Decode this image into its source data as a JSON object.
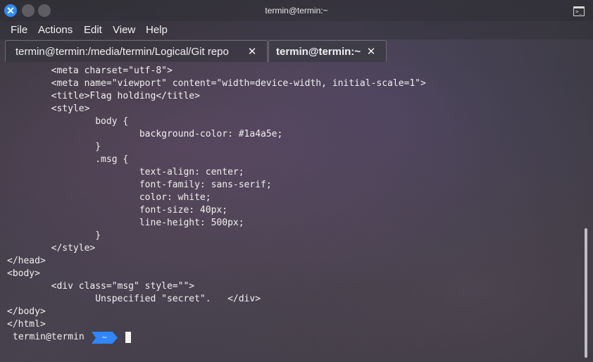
{
  "window": {
    "title": "termin@termin:~",
    "close_glyph": "✕",
    "terminal_icon_glyph": ">_",
    "icons": [
      "close-icon",
      "minimize-icon",
      "maximize-icon",
      "terminal-icon"
    ]
  },
  "menu": {
    "items": [
      {
        "label": "File"
      },
      {
        "label": "Actions"
      },
      {
        "label": "Edit"
      },
      {
        "label": "View"
      },
      {
        "label": "Help"
      }
    ]
  },
  "tabs": [
    {
      "label": "termin@termin:/media/termin/Logical/Git repo",
      "close": "✕",
      "active": false
    },
    {
      "label": "termin@termin:~",
      "close": "✕",
      "active": true
    }
  ],
  "terminal": {
    "lines": [
      "        <meta charset=\"utf-8\">",
      "        <meta name=\"viewport\" content=\"width=device-width, initial-scale=1\">",
      "        <title>Flag holding</title>",
      "        <style>",
      "                body {",
      "                        background-color: #1a4a5e;",
      "                }",
      "                .msg {",
      "                        text-align: center;",
      "                        font-family: sans-serif;",
      "                        color: white;",
      "                        font-size: 40px;",
      "                        line-height: 500px;",
      "                }",
      "        </style>",
      "</head>",
      "<body>",
      "        <div class=\"msg\" style=\"\">",
      "                Unspecified \"secret\".   </div>",
      "</body>",
      "</html>"
    ],
    "prompt": {
      "user": "termin@termin",
      "path": "~"
    }
  },
  "colors": {
    "accent": "#2f8cf0",
    "prompt_segment": "#2f86ff",
    "text": "#f0f0f0"
  }
}
